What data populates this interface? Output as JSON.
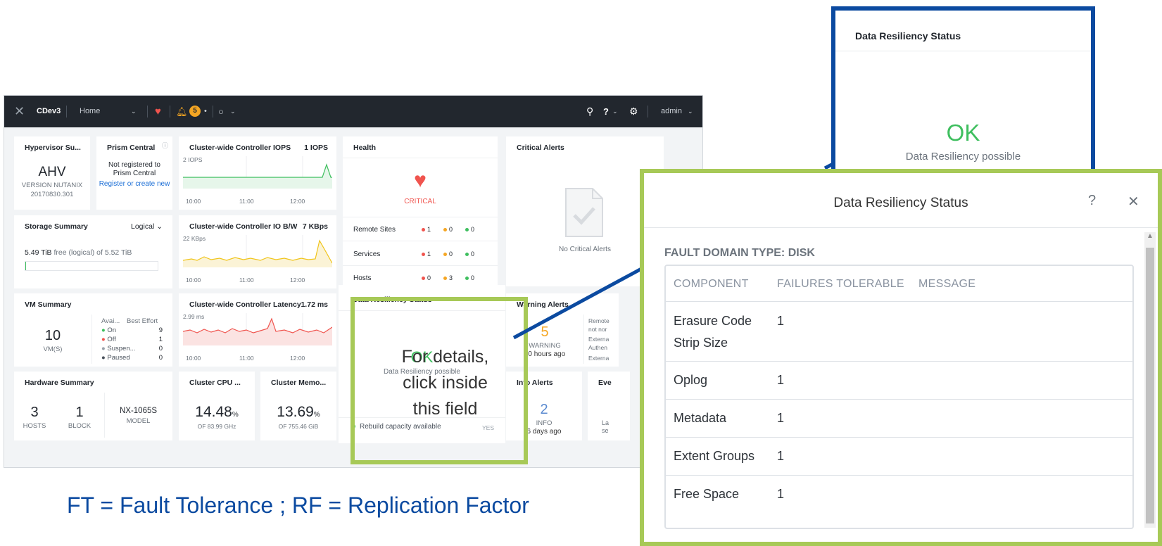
{
  "topbar": {
    "cluster": "CDev3",
    "nav": "Home",
    "alerts_count": "5",
    "user": "admin"
  },
  "widgets": {
    "hypervisor": {
      "title": "Hypervisor Su...",
      "name": "AHV",
      "version": "VERSION NUTANIX",
      "build": "20170830.301"
    },
    "prism": {
      "title": "Prism Central",
      "status_line1": "Not registered to",
      "status_line2": "Prism Central",
      "link": "Register or create new"
    },
    "iops": {
      "title": "Cluster-wide Controller IOPS",
      "value": "1 IOPS",
      "axis_max": "2 IOPS",
      "times": [
        "10:00",
        "11:00",
        "12:00"
      ]
    },
    "health": {
      "title": "Health",
      "status": "CRITICAL",
      "rows": [
        {
          "label": "Remote Sites",
          "red": "1",
          "yellow": "0",
          "green": "0"
        },
        {
          "label": "Services",
          "red": "1",
          "yellow": "0",
          "green": "0"
        },
        {
          "label": "Hosts",
          "red": "0",
          "yellow": "3",
          "green": "0"
        }
      ]
    },
    "critical": {
      "title": "Critical Alerts",
      "empty": "No Critical Alerts"
    },
    "storage": {
      "title": "Storage Summary",
      "mode": "Logical",
      "free": "5.49 TiB",
      "free_note": "free (logical) of 5.52 TiB",
      "usage_fraction": 0.006
    },
    "iobw": {
      "title": "Cluster-wide Controller IO B/W",
      "value": "7 KBps",
      "axis_max": "22 KBps",
      "times": [
        "10:00",
        "11:00",
        "12:00"
      ]
    },
    "vm": {
      "title": "VM Summary",
      "count": "10",
      "unit": "VM(S)",
      "col1": "Avai...",
      "col2": "Best Effort",
      "states": [
        {
          "label": "On",
          "value": "9",
          "color": "#3fbf5f"
        },
        {
          "label": "Off",
          "value": "1",
          "color": "#f0544e"
        },
        {
          "label": "Suspen...",
          "value": "0",
          "color": "#9aa2ab"
        },
        {
          "label": "Paused",
          "value": "0",
          "color": "#4a525c"
        }
      ]
    },
    "latency": {
      "title": "Cluster-wide Controller Latency",
      "value": "1.72 ms",
      "axis_max": "2.99 ms",
      "times": [
        "10:00",
        "11:00",
        "12:00"
      ]
    },
    "resiliency": {
      "title": "Data Resiliency Status",
      "status": "OK",
      "sub": "Data Resiliency possible",
      "footer": "Rebuild capacity available",
      "footer_val": "YES"
    },
    "warning": {
      "title": "Warning Alerts",
      "count": "5",
      "label": "WARNING",
      "when": "20 hours ago",
      "side": [
        "Remote",
        "not nor",
        "Externa",
        "Authen",
        "Externa"
      ]
    },
    "hardware": {
      "title": "Hardware Summary",
      "hosts": "3",
      "hosts_label": "HOSTS",
      "blocks": "1",
      "blocks_label": "BLOCK",
      "model": "NX-1065S",
      "model_label": "MODEL"
    },
    "cpu": {
      "title": "Cluster CPU ...",
      "value": "14.48",
      "unit": "%",
      "sub": "OF 83.99 GHz"
    },
    "memory": {
      "title": "Cluster Memo...",
      "value": "13.69",
      "unit": "%",
      "sub": "OF 755.46 GiB"
    },
    "info": {
      "title": "Info Alerts",
      "count": "2",
      "label": "INFO",
      "when": "6 days ago"
    },
    "events": {
      "title": "Eve",
      "side": [
        "La",
        "se"
      ]
    }
  },
  "overlay": {
    "line1": "For details,",
    "line2": "click inside",
    "line3": "this field"
  },
  "callout": {
    "title": "Data Resiliency Status",
    "status": "OK",
    "sub": "Data Resiliency possible"
  },
  "dialog": {
    "title": "Data Resiliency Status",
    "help": "?",
    "close": "✕",
    "fault_domain": "FAULT DOMAIN TYPE: DISK",
    "columns": [
      "COMPONENT",
      "FAILURES TOLERABLE",
      "MESSAGE"
    ],
    "rows": [
      {
        "component_1": "Erasure Code",
        "component_2": "Strip Size",
        "failures": "1"
      },
      {
        "component_1": "Oplog",
        "component_2": "",
        "failures": "1"
      },
      {
        "component_1": "Metadata",
        "component_2": "",
        "failures": "1"
      },
      {
        "component_1": "Extent Groups",
        "component_2": "",
        "failures": "1"
      },
      {
        "component_1": "Free Space",
        "component_2": "",
        "failures": "1"
      }
    ]
  },
  "caption": "FT = Fault Tolerance ; RF = Replication Factor",
  "colors": {
    "accent_green": "#a7c957",
    "accent_blue": "#0b4aa0",
    "ok_green": "#3fbf5f",
    "critical_red": "#f0544e",
    "warning_yellow": "#f5a623"
  }
}
